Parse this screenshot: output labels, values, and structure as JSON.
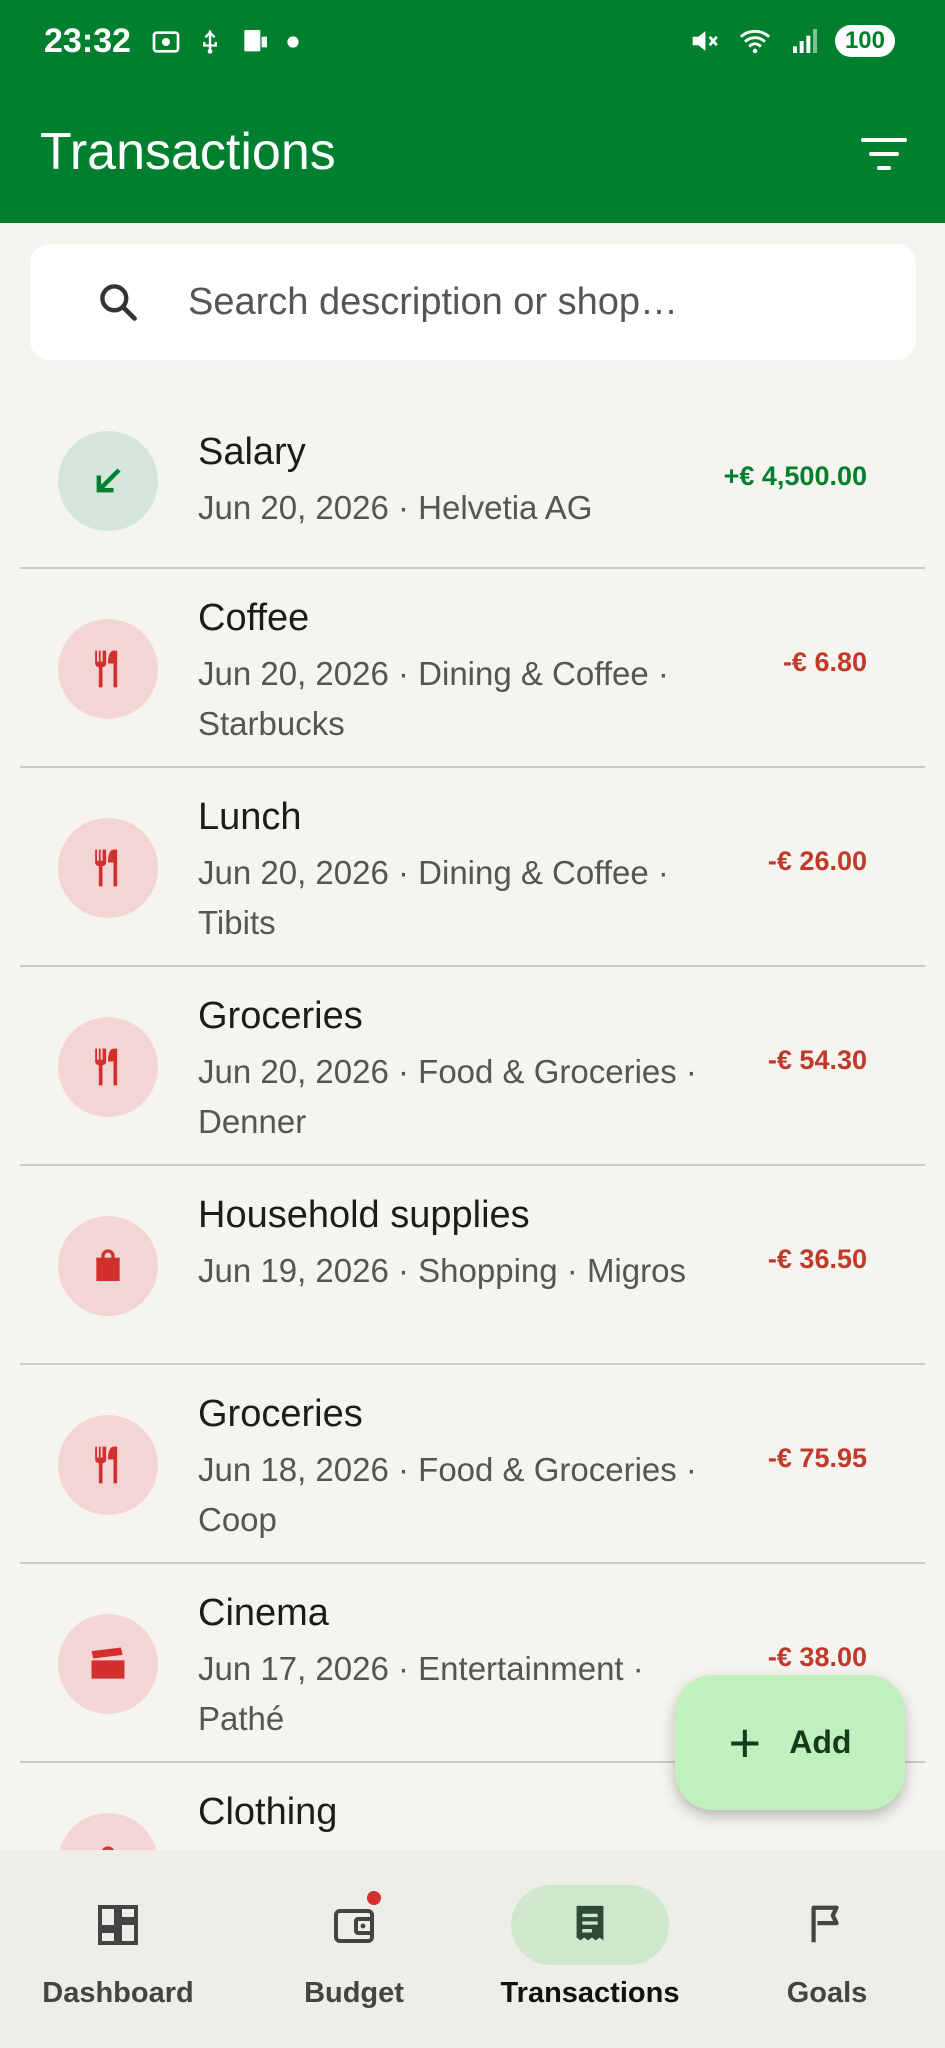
{
  "status_bar": {
    "time": "23:32",
    "battery": "100"
  },
  "app_bar": {
    "title": "Transactions"
  },
  "search": {
    "placeholder": "Search description or shop…"
  },
  "transactions": [
    {
      "title": "Salary",
      "subtitle": "Jun 20, 2026 · Helvetia AG",
      "amount": "+€ 4,500.00",
      "icon": "arrow-down-left-icon"
    },
    {
      "title": "Coffee",
      "subtitle": "Jun 20, 2026 · Dining & Coffee · Starbucks",
      "amount": "-€ 6.80",
      "icon": "restaurant-icon"
    },
    {
      "title": "Lunch",
      "subtitle": "Jun 20, 2026 · Dining & Coffee · Tibits",
      "amount": "-€ 26.00",
      "icon": "restaurant-icon"
    },
    {
      "title": "Groceries",
      "subtitle": "Jun 20, 2026 · Food & Groceries · Denner",
      "amount": "-€ 54.30",
      "icon": "restaurant-icon"
    },
    {
      "title": "Household supplies",
      "subtitle": "Jun 19, 2026 · Shopping · Migros",
      "amount": "-€ 36.50",
      "icon": "shopping-bag-icon"
    },
    {
      "title": "Groceries",
      "subtitle": "Jun 18, 2026 · Food & Groceries · Coop",
      "amount": "-€ 75.95",
      "icon": "restaurant-icon"
    },
    {
      "title": "Cinema",
      "subtitle": "Jun 17, 2026 · Entertainment · Pathé",
      "amount": "-€ 38.00",
      "icon": "clapperboard-icon"
    },
    {
      "title": "Clothing",
      "subtitle": "",
      "amount": "",
      "icon": "shopping-bag-icon"
    }
  ],
  "fab": {
    "label": "Add"
  },
  "nav": {
    "dashboard": "Dashboard",
    "budget": "Budget",
    "transactions": "Transactions",
    "goals": "Goals"
  },
  "colors": {
    "primary": "#00802f",
    "expense": "#c0392b",
    "income": "#00802f",
    "fab": "#bff0bd"
  }
}
